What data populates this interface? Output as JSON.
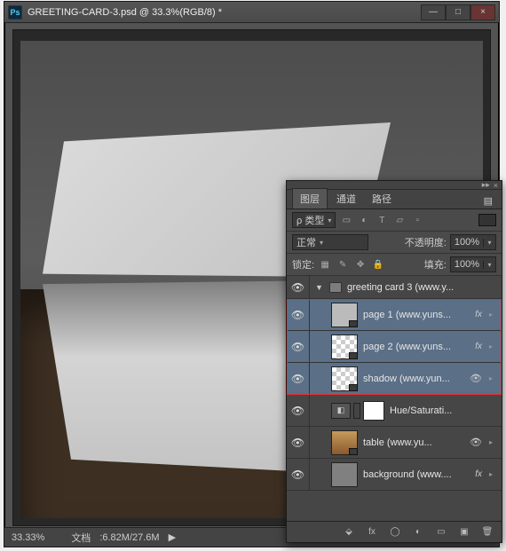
{
  "window": {
    "app_icon_text": "Ps",
    "title": "GREETING-CARD-3.psd @ 33.3%(RGB/8) *"
  },
  "status": {
    "zoom": "33.33%",
    "doc_label": "文档",
    "doc_size": ":6.82M/27.6M"
  },
  "panel": {
    "tabs": {
      "layers": "图层",
      "channels": "通道",
      "paths": "路径"
    },
    "filter_label": "ρ 类型",
    "blend_mode": "正常",
    "opacity_label": "不透明度:",
    "opacity_value": "100%",
    "lock_label": "锁定:",
    "fill_label": "填充:",
    "fill_value": "100%",
    "group_name": "greeting card 3  (www.y...",
    "layers": [
      {
        "name": "page 1 (www.yuns...",
        "fx": "fx"
      },
      {
        "name": "page 2 (www.yuns...",
        "fx": "fx"
      },
      {
        "name": "shadow (www.yun...",
        "fx": ""
      }
    ],
    "adjustment_name": "Hue/Saturati...",
    "table_name": "table (www.yu...",
    "bg_name": "background (www....",
    "bg_fx": "fx"
  },
  "icons": {
    "minimize": "—",
    "maximize": "□",
    "close": "×",
    "eye": "👁",
    "collapse": "▸▸",
    "panel_close": "×",
    "menu": "▤",
    "caret": "▾",
    "tri_down": "▼",
    "tri_right": "▸",
    "arrow_r": "▶",
    "link": "⬙",
    "fx": "fx",
    "mask": "◯",
    "adjust": "◐",
    "folder": "▭",
    "new": "▣",
    "trash": "🗑",
    "lock_img": "▦",
    "lock_brush": "✎",
    "lock_pos": "✥",
    "lock_all": "🔒",
    "filter_img": "▭",
    "filter_adj": "◐",
    "filter_txt": "T",
    "filter_shape": "▱",
    "filter_smart": "▫"
  }
}
